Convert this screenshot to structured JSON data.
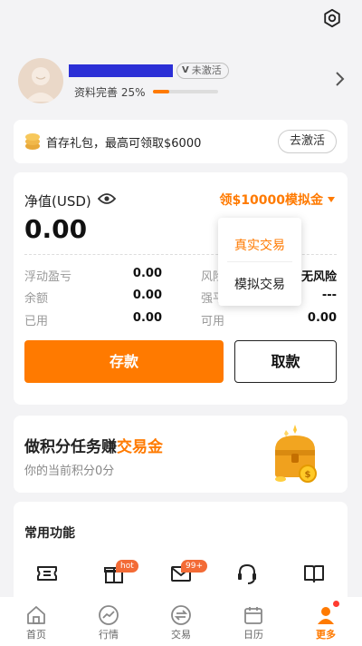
{
  "profile": {
    "badge": "未激活",
    "completion_label": "资料完善 25%",
    "completion_fraction": 0.25
  },
  "gift": {
    "text": "首存礼包，最高可领取$6000",
    "button": "去激活"
  },
  "account": {
    "nav_label": "净值(USD)",
    "nav_value": "0.00",
    "demo_link": "领$10000模拟金",
    "rows": [
      {
        "left_label": "浮动盈亏",
        "left_value": "0.00",
        "right_label": "风险",
        "right_value": "无风险"
      },
      {
        "left_label": "余额",
        "left_value": "0.00",
        "right_label": "强平",
        "right_value": "---"
      },
      {
        "left_label": "已用",
        "left_value": "0.00",
        "right_label": "可用",
        "right_value": "0.00"
      }
    ],
    "deposit": "存款",
    "withdraw": "取款"
  },
  "dropdown": {
    "items": [
      "真实交易",
      "模拟交易"
    ]
  },
  "task": {
    "title_prefix": "做积分任务赚",
    "title_highlight": "交易金",
    "subtitle": "你的当前积分0分"
  },
  "functions": {
    "title": "常用功能",
    "tags": {
      "gift": "hot",
      "mail": "99+"
    }
  },
  "tabbar": {
    "items": [
      {
        "label": "首页",
        "icon": "home-icon"
      },
      {
        "label": "行情",
        "icon": "trend-icon"
      },
      {
        "label": "交易",
        "icon": "exchange-icon"
      },
      {
        "label": "日历",
        "icon": "calendar-icon"
      },
      {
        "label": "更多",
        "icon": "person-icon"
      }
    ]
  },
  "colors": {
    "accent": "#ff7a00",
    "name_redaction": "#2b2fd6"
  }
}
